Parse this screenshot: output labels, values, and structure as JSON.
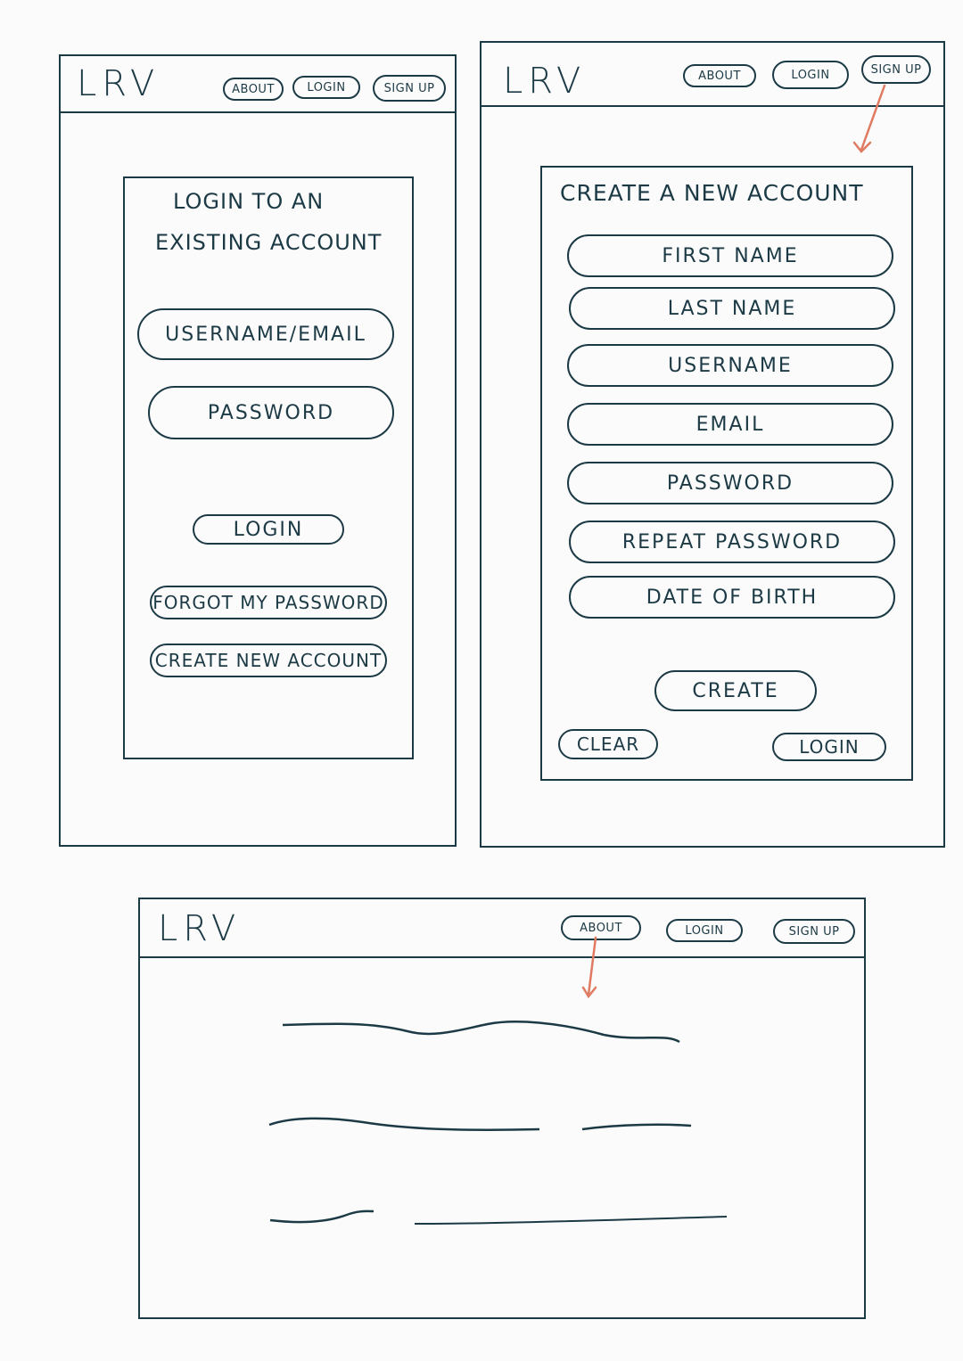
{
  "brand": {
    "logo": "LRV"
  },
  "nav": {
    "about": "ABOUT",
    "login": "LOGIN",
    "signup": "SIGN UP"
  },
  "login_page": {
    "title_line1": "LOGIN TO AN",
    "title_line2": "EXISTING ACCOUNT",
    "username_placeholder": "USERNAME/EMAIL",
    "password_placeholder": "PASSWORD",
    "login_button": "LOGIN",
    "forgot_button": "FORGOT MY PASSWORD",
    "create_button": "CREATE NEW ACCOUNT"
  },
  "signup_page": {
    "title": "CREATE A NEW ACCOUNT",
    "first_name": "FIRST NAME",
    "last_name": "LAST NAME",
    "username": "USERNAME",
    "email": "EMAIL",
    "password": "PASSWORD",
    "repeat_password": "REPEAT PASSWORD",
    "date_of_birth": "DATE OF BIRTH",
    "create_button": "CREATE",
    "clear_button": "CLEAR",
    "login_button": "LOGIN"
  },
  "colors": {
    "ink": "#1c3a45",
    "arrow": "#e07a60",
    "paper": "#fbfbfb"
  }
}
